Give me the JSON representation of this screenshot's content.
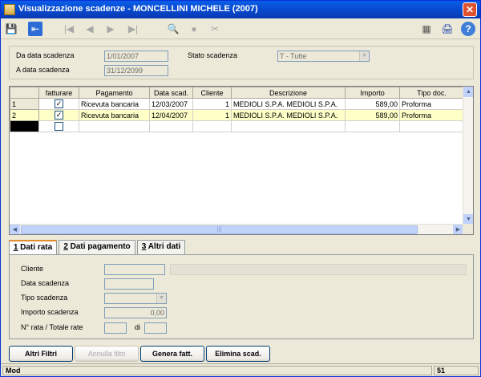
{
  "window": {
    "title": "Visualizzazione scadenze  -  MONCELLINI MICHELE (2007)",
    "close_glyph": "✕"
  },
  "toolbar": {
    "icons": [
      "save-icon",
      "exit-icon",
      "first-record-icon",
      "prev-record-icon",
      "next-record-icon",
      "last-record-icon",
      "search-icon",
      "record-icon",
      "filter-delete-icon",
      "calculator-icon",
      "print-icon",
      "help-icon"
    ],
    "glyphs": {
      "save": "💾",
      "exit": "⇤",
      "first": "|◀",
      "prev": "◀",
      "next": "▶",
      "last": "▶|",
      "search": "🔍",
      "record": "●",
      "filterdel": "✂",
      "calc": "▦",
      "print": "🖨",
      "help": "?"
    }
  },
  "filters": {
    "da_data_label": "Da data scadenza",
    "da_data_value": "1/01/2007",
    "a_data_label": "A data scadenza",
    "a_data_value": "31/12/2099",
    "stato_label": "Stato scadenza",
    "stato_value": "T - Tutte"
  },
  "grid": {
    "columns": [
      "",
      "fatturare",
      "Pagamento",
      "Data scad.",
      "Cliente",
      "Descrizione",
      "Importo",
      "Tipo doc."
    ],
    "rows": [
      {
        "n": "1",
        "fatturare": true,
        "pagamento": "Ricevuta bancaria",
        "data": "12/03/2007",
        "cliente": "1",
        "descrizione": "MEDIOLI S.P.A. MEDIOLI S.P.A.",
        "importo": "589,00",
        "tipo": "Proforma"
      },
      {
        "n": "2",
        "fatturare": true,
        "pagamento": "Ricevuta bancaria",
        "data": "12/04/2007",
        "cliente": "1",
        "descrizione": "MEDIOLI S.P.A. MEDIOLI S.P.A.",
        "importo": "589,00",
        "tipo": "Proforma"
      }
    ],
    "check_glyph": "✓"
  },
  "tabs": [
    {
      "key": "1",
      "label": " Dati rata",
      "active": true
    },
    {
      "key": "2",
      "label": " Dati pagamento",
      "active": false
    },
    {
      "key": "3",
      "label": " Altri dati",
      "active": false
    }
  ],
  "details": {
    "cliente_label": "Cliente",
    "data_label": "Data scadenza",
    "tipo_label": "Tipo scadenza",
    "importo_label": "Importo scadenza",
    "importo_value": "0,00",
    "rata_label": "N° rata / Totale rate",
    "di_label": "di"
  },
  "buttons": {
    "altri_filtri": "Altri Filtri",
    "annulla_filtri": "Annulla filtri",
    "genera_fatt": "Genera fatt.",
    "elimina_scad": "Elimina scad."
  },
  "status": {
    "mode": "Mod",
    "count": "51"
  }
}
